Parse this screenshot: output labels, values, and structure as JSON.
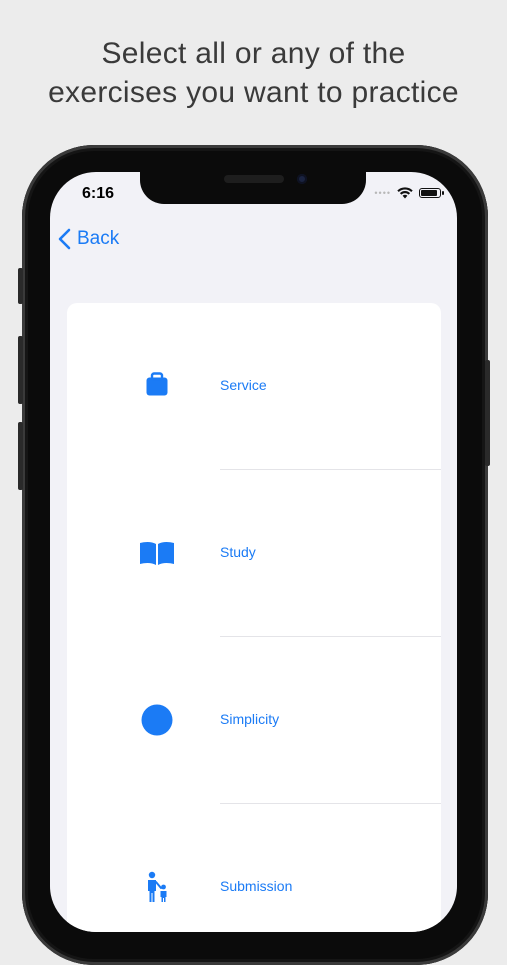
{
  "headline": {
    "line1": "Select all or any of the",
    "line2": "exercises you want to practice"
  },
  "status_bar": {
    "time": "6:16",
    "icons": [
      "cellular-dots-icon",
      "wifi-icon",
      "battery-icon"
    ]
  },
  "nav": {
    "back_label": "Back",
    "back_icon": "chevron-left-icon"
  },
  "exercises": [
    {
      "label": "Service",
      "icon": "briefcase-icon"
    },
    {
      "label": "Study",
      "icon": "book-icon"
    },
    {
      "label": "Simplicity",
      "icon": "circle-icon"
    },
    {
      "label": "Submission",
      "icon": "parent-child-icon"
    }
  ],
  "colors": {
    "accent": "#1B7BF5",
    "background": "#ECECEC",
    "screen": "#F2F2F7",
    "card": "#FFFFFF"
  }
}
